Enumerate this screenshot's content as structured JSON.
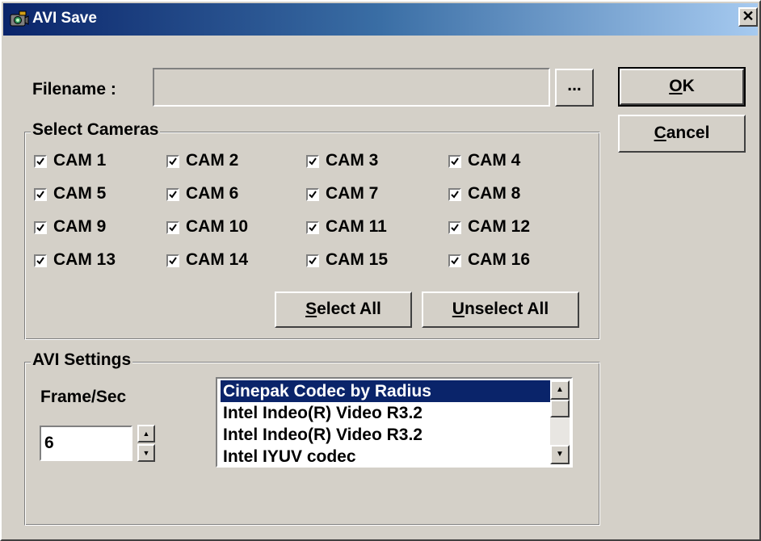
{
  "window": {
    "title": "AVI Save"
  },
  "filename": {
    "label": "Filename :",
    "value": "",
    "browse_label": "..."
  },
  "buttons": {
    "ok": {
      "mnemonic": "O",
      "rest": "K"
    },
    "cancel": {
      "mnemonic": "C",
      "rest": "ancel"
    },
    "select_all": {
      "mnemonic": "S",
      "rest": "elect All"
    },
    "unselect_all": {
      "mnemonic": "U",
      "rest": "nselect All"
    }
  },
  "cameras": {
    "title": "Select Cameras",
    "items": [
      {
        "label": "CAM 1",
        "checked": true
      },
      {
        "label": "CAM 2",
        "checked": true
      },
      {
        "label": "CAM 3",
        "checked": true
      },
      {
        "label": "CAM 4",
        "checked": true
      },
      {
        "label": "CAM 5",
        "checked": true
      },
      {
        "label": "CAM 6",
        "checked": true
      },
      {
        "label": "CAM 7",
        "checked": true
      },
      {
        "label": "CAM 8",
        "checked": true
      },
      {
        "label": "CAM 9",
        "checked": true
      },
      {
        "label": "CAM 10",
        "checked": true
      },
      {
        "label": "CAM 11",
        "checked": true
      },
      {
        "label": "CAM 12",
        "checked": true
      },
      {
        "label": "CAM 13",
        "checked": true
      },
      {
        "label": "CAM 14",
        "checked": true
      },
      {
        "label": "CAM 15",
        "checked": true
      },
      {
        "label": "CAM 16",
        "checked": true
      }
    ]
  },
  "avi": {
    "title": "AVI Settings",
    "fps_label": "Frame/Sec",
    "fps_value": "6",
    "codecs": [
      {
        "label": "Cinepak Codec by Radius",
        "selected": true
      },
      {
        "label": "Intel Indeo(R) Video R3.2",
        "selected": false
      },
      {
        "label": "Intel Indeo(R) Video R3.2",
        "selected": false
      },
      {
        "label": "Intel IYUV codec",
        "selected": false
      }
    ]
  },
  "colors": {
    "selection": "#0a246a",
    "face": "#d4d0c8",
    "title_start": "#0a246a",
    "title_end": "#a6caf0"
  }
}
